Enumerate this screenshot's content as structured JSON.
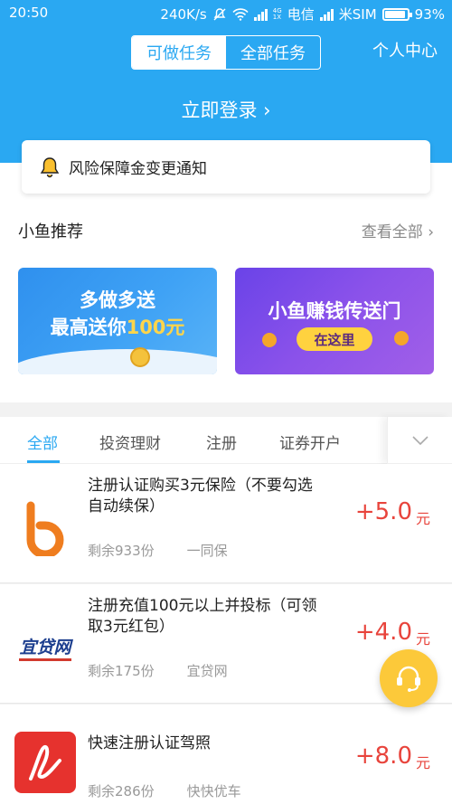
{
  "status_bar": {
    "time": "20:50",
    "net_speed": "240K/s",
    "net_badge": "4G 1X",
    "carrier1": "电信",
    "carrier2": "米SIM",
    "battery": "93%"
  },
  "header": {
    "tabs": [
      {
        "label": "可做任务",
        "active": true
      },
      {
        "label": "全部任务",
        "active": false
      }
    ],
    "center_link": "个人中心",
    "login": "立即登录 ›"
  },
  "notice": {
    "text": "风险保障金变更通知"
  },
  "recommend": {
    "title": "小鱼推荐",
    "more": "查看全部 ›",
    "banners": [
      {
        "line1": "多做多送",
        "line2_prefix": "最高送你",
        "line2_highlight": "100元"
      },
      {
        "line1": "小鱼赚钱传送门",
        "button": "在这里"
      }
    ]
  },
  "filter_tabs": {
    "items": [
      {
        "label": "全部",
        "active": true
      },
      {
        "label": "投资理财",
        "active": false
      },
      {
        "label": "注册",
        "active": false
      },
      {
        "label": "证券开户",
        "active": false
      }
    ]
  },
  "tasks": [
    {
      "title": "注册认证购买3元保险（不要勾选自动续保）",
      "remaining": "剩余933份",
      "source": "一同保",
      "reward": "+5.0",
      "unit": "元",
      "logo": "yitongbao-logo"
    },
    {
      "title": "注册充值100元以上并投标（可领取3元红包）",
      "remaining": "剩余175份",
      "source": "宜贷网",
      "reward": "+4.0",
      "unit": "元",
      "logo": "yidaiwang-logo",
      "logo_text": "宜贷网"
    },
    {
      "title": "快速注册认证驾照",
      "remaining": "剩余286份",
      "source": "快快优车",
      "reward": "+8.0",
      "unit": "元",
      "logo": "kuaikuaiyouche-logo"
    }
  ],
  "colors": {
    "primary": "#2aa8f2",
    "reward": "#e8443c",
    "fab": "#fcc93a"
  }
}
